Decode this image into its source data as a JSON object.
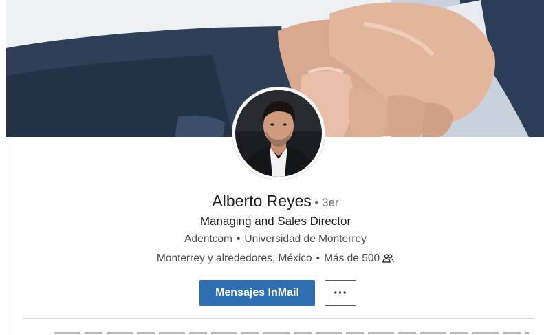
{
  "profile": {
    "name": "Alberto Reyes",
    "degree": "• 3er",
    "headline": "Managing and Sales Director",
    "company": "Adentcom",
    "school": "Universidad de Monterrey",
    "location": "Monterrey y alrededores, México",
    "connections": "Más de 500",
    "separator": "•"
  },
  "actions": {
    "inmail_label": "Mensajes InMail",
    "more_label": "···"
  },
  "colors": {
    "primary_button": "#2d6fb0",
    "text_main": "#1f1f1f",
    "text_secondary": "#4a4a4a"
  },
  "icons": {
    "connections": "people-icon",
    "more": "ellipsis-icon"
  }
}
